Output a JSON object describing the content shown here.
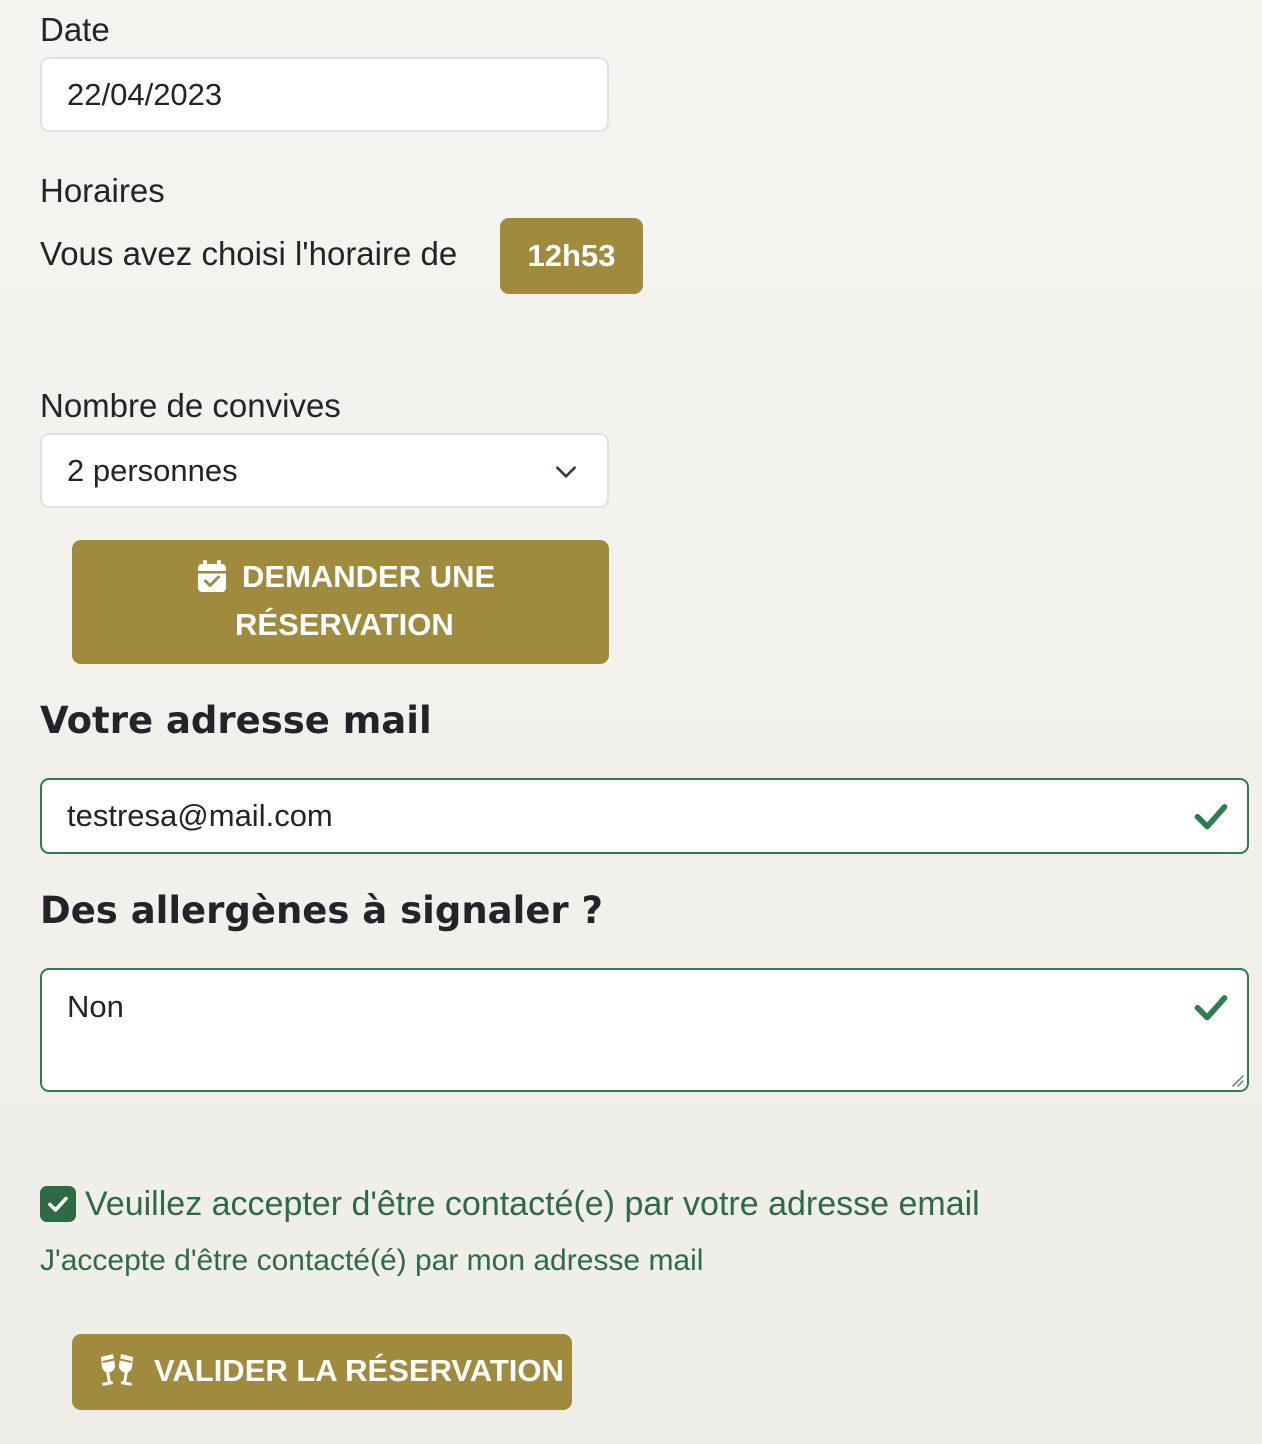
{
  "date": {
    "label": "Date",
    "value": "22/04/2023"
  },
  "schedule": {
    "label": "Horaires",
    "chosen_text": "Vous avez choisi l'horaire de",
    "time": "12h53"
  },
  "guests": {
    "label": "Nombre de convives",
    "selected": "2 personnes",
    "icon": "chevron-down-icon"
  },
  "request_button": {
    "line1": "Demander une",
    "line2": "réservation",
    "icon": "calendar-check-icon"
  },
  "email": {
    "heading": "Votre adresse mail",
    "value": "testresa@mail.com",
    "valid_icon": "check-icon"
  },
  "allergens": {
    "heading": "Des allergènes à signaler ?",
    "value": "Non",
    "valid_icon": "check-icon"
  },
  "consent": {
    "checked": true,
    "label": "Veuillez accepter d'être contacté(e) par votre adresse email",
    "feedback": "J'accepte d'être contacté(é) par mon adresse mail"
  },
  "submit_button": {
    "label": "Valider la réservation",
    "icon": "glasses-cheers-icon"
  },
  "colors": {
    "accent": "#a08a3d",
    "valid": "#2e7d4f",
    "consent_green": "#2e6b45",
    "background": "#f5f4f0"
  }
}
